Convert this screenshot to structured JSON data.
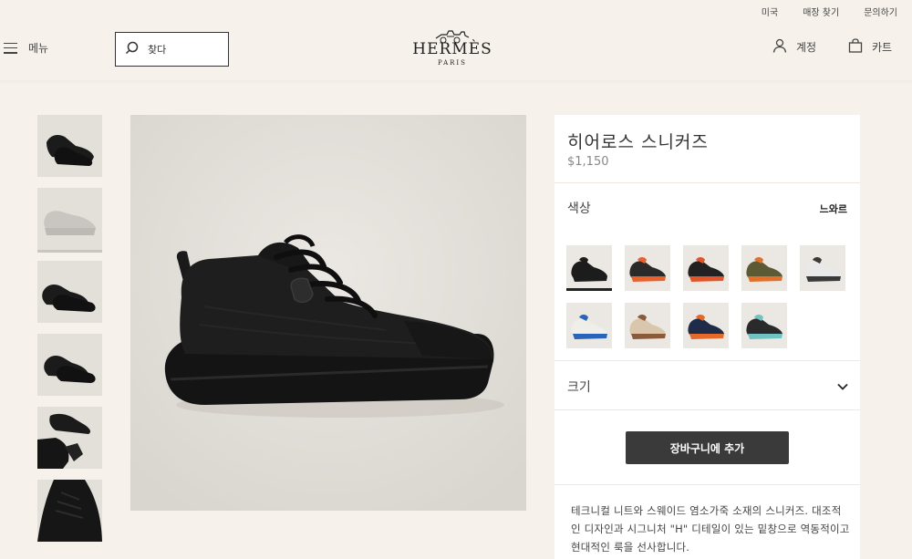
{
  "utility_nav": [
    "미국",
    "매장 찾기",
    "문의하기"
  ],
  "header": {
    "menu_label": "메뉴",
    "search_placeholder": "찾다",
    "brand": "HERMÈS",
    "brand_city": "PARIS",
    "account_label": "계정",
    "cart_label": "카트"
  },
  "product": {
    "title": "히어로스 스니커즈",
    "price": "$1,150",
    "color_label": "색상",
    "color_value": "느와르",
    "size_label": "크기",
    "add_to_cart": "장바구니에 추가",
    "description": "테크니컬 니트와 스웨이드 염소가죽 소재의 스니커즈. 대조적인 디자인과 시그니처 \"H\" 디테일이 있는 밑창으로 역동적이고 현대적인 룩을 선사합니다."
  },
  "gallery": {
    "thumbnails": [
      {
        "name": "thumb-black-pair",
        "tone": "#1b1b1b"
      },
      {
        "name": "thumb-grey-side",
        "tone": "#c9c6c2"
      },
      {
        "name": "thumb-black-pair-side",
        "tone": "#1b1b1b"
      },
      {
        "name": "thumb-black-pair-back",
        "tone": "#1b1b1b"
      },
      {
        "name": "thumb-black-worn",
        "tone": "#1b1b1b"
      },
      {
        "name": "thumb-black-closeup",
        "tone": "#1b1b1b"
      }
    ],
    "active_index": 1
  },
  "swatches": [
    {
      "name": "black",
      "base": "#1c1c1c",
      "accent": "#1c1c1c",
      "selected": true
    },
    {
      "name": "black-orange",
      "base": "#2a2a2a",
      "accent": "#e8622e"
    },
    {
      "name": "black-orange-2",
      "base": "#222222",
      "accent": "#e2552a"
    },
    {
      "name": "olive-orange",
      "base": "#5b5a35",
      "accent": "#e0702c"
    },
    {
      "name": "white-grey",
      "base": "#e9e9e9",
      "accent": "#3a3a3a"
    },
    {
      "name": "white-blue",
      "base": "#f0eee8",
      "accent": "#2a64b7"
    },
    {
      "name": "beige-brown",
      "base": "#d8c7ad",
      "accent": "#8b5a3a"
    },
    {
      "name": "navy-orange",
      "base": "#1e2c4a",
      "accent": "#e46a2c"
    },
    {
      "name": "black-teal",
      "base": "#2a2a2a",
      "accent": "#6fc3c3"
    }
  ],
  "colors": {
    "page_bg": "#f6f1eb",
    "panel_bg": "#ffffff",
    "button_bg": "#3a3a3a",
    "image_bg": "#e4e0da"
  }
}
